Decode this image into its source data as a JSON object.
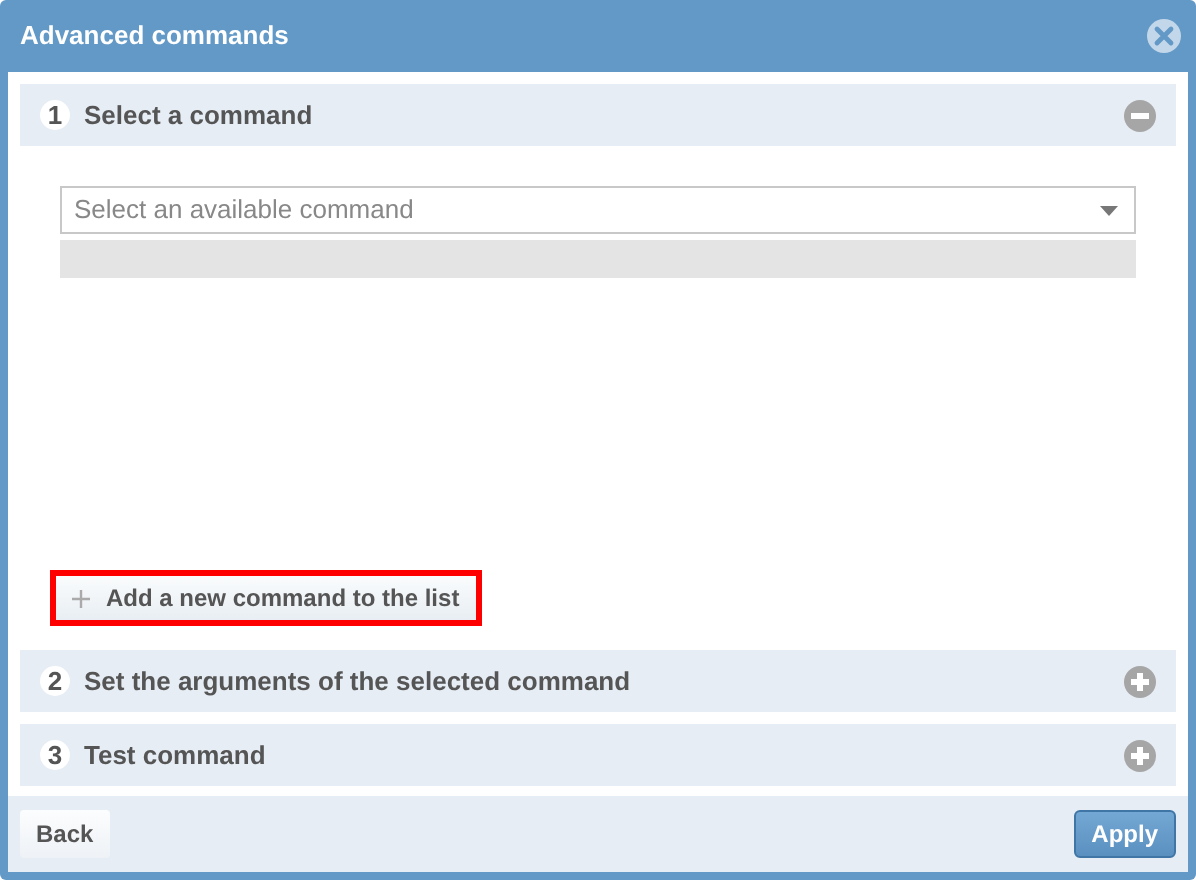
{
  "window": {
    "title": "Advanced commands"
  },
  "sections": [
    {
      "number": "1",
      "title": "Select a command",
      "expanded": true,
      "select": {
        "placeholder": "Select an available command"
      },
      "add_button": {
        "label": "Add a new command to the list",
        "highlighted": true
      }
    },
    {
      "number": "2",
      "title": "Set the arguments of the selected command",
      "expanded": false
    },
    {
      "number": "3",
      "title": "Test command",
      "expanded": false
    }
  ],
  "buttons": [
    {
      "label": "Back",
      "kind": "secondary"
    },
    {
      "label": "Apply",
      "kind": "primary"
    }
  ]
}
